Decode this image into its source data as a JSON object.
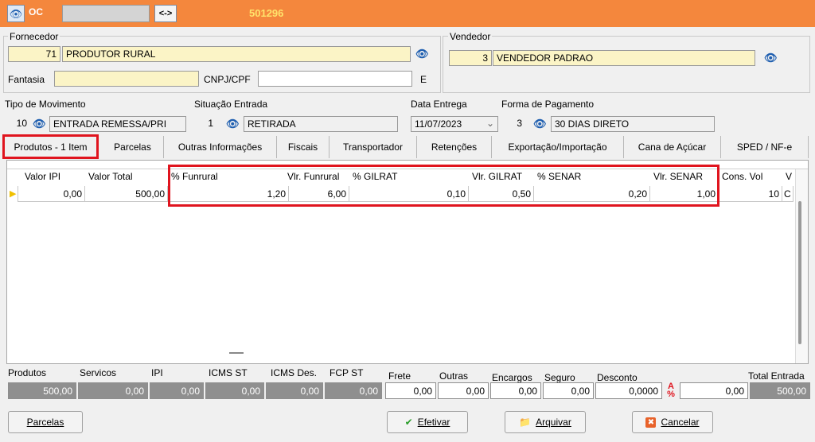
{
  "header": {
    "icon_label": "OC",
    "id": "501296",
    "nav_label": "<->"
  },
  "supplier": {
    "group_label": "Fornecedor",
    "code": "71",
    "name": "PRODUTOR RURAL",
    "fantasia_label": "Fantasia",
    "fantasia_value": "",
    "cnpj_label": "CNPJ/CPF",
    "cnpj_value": "",
    "type_code": "E"
  },
  "seller": {
    "group_label": "Vendedor",
    "code": "3",
    "name": "VENDEDOR PADRAO"
  },
  "movement": {
    "label": "Tipo  de Movimento",
    "code": "10",
    "name": "ENTRADA REMESSA/PRI"
  },
  "entry_status": {
    "label": "Situação Entrada",
    "code": "1",
    "name": "RETIRADA"
  },
  "delivery_date": {
    "label": "Data Entrega",
    "value": "11/07/2023"
  },
  "payment": {
    "label": "Forma de Pagamento",
    "code": "3",
    "name": "30 DIAS DIRETO"
  },
  "tabs": [
    {
      "label": "Produtos - 1 Item"
    },
    {
      "label": "Parcelas"
    },
    {
      "label": "Outras Informações"
    },
    {
      "label": "Fiscais"
    },
    {
      "label": "Transportador"
    },
    {
      "label": "Retenções"
    },
    {
      "label": "Exportação/Importação"
    },
    {
      "label": "Cana de Açúcar"
    },
    {
      "label": "SPED / NF-e"
    }
  ],
  "grid": {
    "columns": [
      "Valor IPI",
      "Valor Total",
      "% Funrural",
      "Vlr. Funrural",
      "% GILRAT",
      "Vlr. GILRAT",
      "% SENAR",
      "Vlr. SENAR",
      "Cons. Vol",
      "V"
    ],
    "rows": [
      [
        "0,00",
        "500,00",
        "1,20",
        "6,00",
        "0,10",
        "0,50",
        "0,20",
        "1,00",
        "10",
        "C"
      ]
    ]
  },
  "totals": {
    "labels": [
      "Produtos",
      "Servicos",
      "IPI",
      "ICMS ST",
      "ICMS Des.",
      "FCP ST",
      "Frete",
      "Outras",
      "Encargos",
      "Seguro",
      "Desconto",
      "Total Entrada"
    ],
    "produtos": "500,00",
    "servicos": "0,00",
    "ipi": "0,00",
    "icms_st": "0,00",
    "icms_des": "0,00",
    "fcp_st": "0,00",
    "frete": "0,00",
    "outras": "0,00",
    "encargos": "0,00",
    "seguro": "0,00",
    "desconto_pct": "0,0000",
    "desconto": "0,00",
    "total": "500,00"
  },
  "buttons": {
    "parcelas": "Parcelas",
    "efetivar": "Efetivar",
    "arquivar": "Arquivar",
    "cancelar": "Cancelar"
  },
  "colors": {
    "topbar": "#f4873d",
    "highlight": "#e0141e",
    "yellow_field": "#fbf4c6"
  }
}
